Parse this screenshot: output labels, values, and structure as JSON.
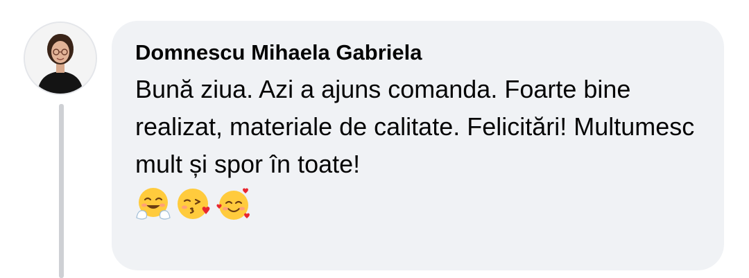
{
  "comment": {
    "author": "Domnescu Mihaela Gabriela",
    "text": "Bună ziua. Azi a ajuns comanda. Foarte bine realizat, materiale de calitate. Felicitări! Multumesc mult și spor în toate!",
    "emojis": [
      "hugging-face-icon",
      "face-blowing-kiss-icon",
      "smiling-face-with-hearts-icon"
    ]
  },
  "colors": {
    "bubble_background": "#f0f2f5",
    "thread_line": "#ced0d4",
    "text": "#050505"
  }
}
